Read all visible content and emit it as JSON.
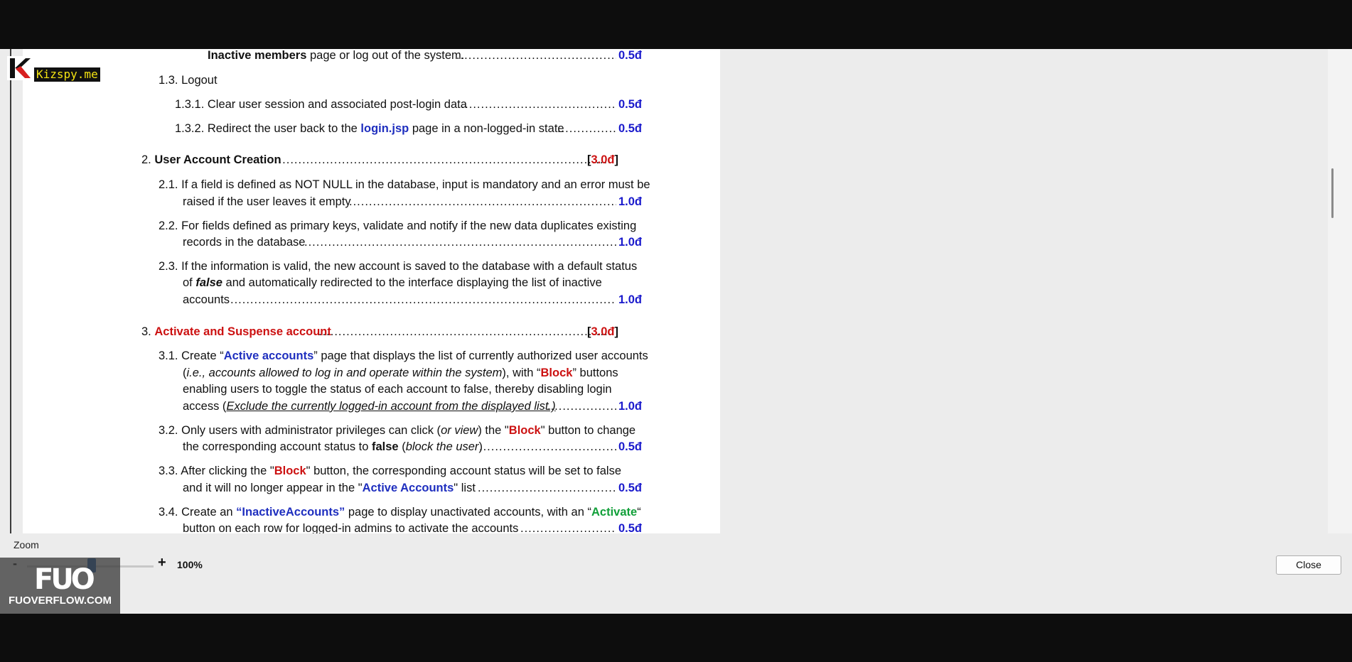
{
  "document": {
    "lines": {
      "l0": {
        "a": "Inactive members",
        "b": " page or log out of the system.",
        "pts": "0.5đ"
      },
      "l1": {
        "t": "1.3. Logout"
      },
      "l2": {
        "t": "1.3.1. Clear user session and associated post-login data",
        "pts": "0.5đ"
      },
      "l3": {
        "a": "1.3.2. Redirect the user back to the ",
        "b": "login.jsp",
        "c": " page in a non-logged-in state",
        "pts": "0.5đ"
      },
      "l4": {
        "n": "2. ",
        "t": "User Account Creation",
        "pts_open": "[",
        "pts": "3.0đ",
        "pts_close": "]"
      },
      "l5": {
        "t": "2.1. If a field is defined as NOT NULL in the database, input is mandatory and an error must be"
      },
      "l6": {
        "t": "raised if the user leaves it empty",
        "pts": "1.0đ"
      },
      "l7": {
        "t": "2.2. For fields defined as primary keys, validate and notify if the new data duplicates existing"
      },
      "l8": {
        "t": "records in the database",
        "pts": "1.0đ"
      },
      "l9": {
        "t": "2.3. If the information is valid, the new account is saved to the database with a default status"
      },
      "l10": {
        "a": "of ",
        "b": "false",
        "c": " and automatically redirected to the interface displaying the list of inactive"
      },
      "l11": {
        "t": "accounts",
        "pts": "1.0đ"
      },
      "l12": {
        "n": "3. ",
        "t": "Activate and Suspense account",
        "pts_open": "[",
        "pts": "3.0đ",
        "pts_close": "]"
      },
      "l13": {
        "a": "3.1. Create “",
        "b": "Active accounts",
        "c": "” page that displays the list of currently authorized user accounts"
      },
      "l14": {
        "a": "(",
        "b": "i.e., accounts allowed to log in and operate within the system",
        "c": "), with “",
        "d": "Block",
        "e": "” buttons"
      },
      "l15": {
        "t": "enabling users to toggle the status of each account to false, thereby disabling login"
      },
      "l16": {
        "a": "access (",
        "b": "Exclude the currently logged-in account from the displayed list.)",
        "pts": "1.0đ"
      },
      "l17": {
        "a": "3.2. Only users with administrator privileges can click (",
        "b": "or view",
        "c": ") the \"",
        "d": "Block",
        "e": "\" button to change"
      },
      "l18": {
        "a": "the corresponding account status to ",
        "b": "false",
        "c": " (",
        "d": "block the user",
        "e": ")",
        "pts": "0.5đ"
      },
      "l19": {
        "a": "3.3. After clicking the \"",
        "b": "Block",
        "c": "\" button, the corresponding account status will be set to false"
      },
      "l20": {
        "a": "and it will no longer appear in the \"",
        "b": "Active Accounts",
        "c": "\" list",
        "pts": "0.5đ"
      },
      "l21": {
        "a": "3.4. Create an ",
        "b": "“InactiveAccounts”",
        "c": " page to display unactivated accounts, with an “",
        "d": "Activate",
        "e": "“"
      },
      "l22": {
        "t": "button on each row for logged-in admins to activate the accounts",
        "pts": "0.5đ"
      }
    }
  },
  "zoom": {
    "label": "Zoom",
    "minus": "-",
    "plus": "+",
    "value": "100%",
    "level_percent": 100
  },
  "close_button": "Close",
  "watermarks": {
    "kizspy": "Kizspy.me",
    "fuo_logo": "FUO",
    "fuo_site": "FUOVERFLOW.COM"
  }
}
